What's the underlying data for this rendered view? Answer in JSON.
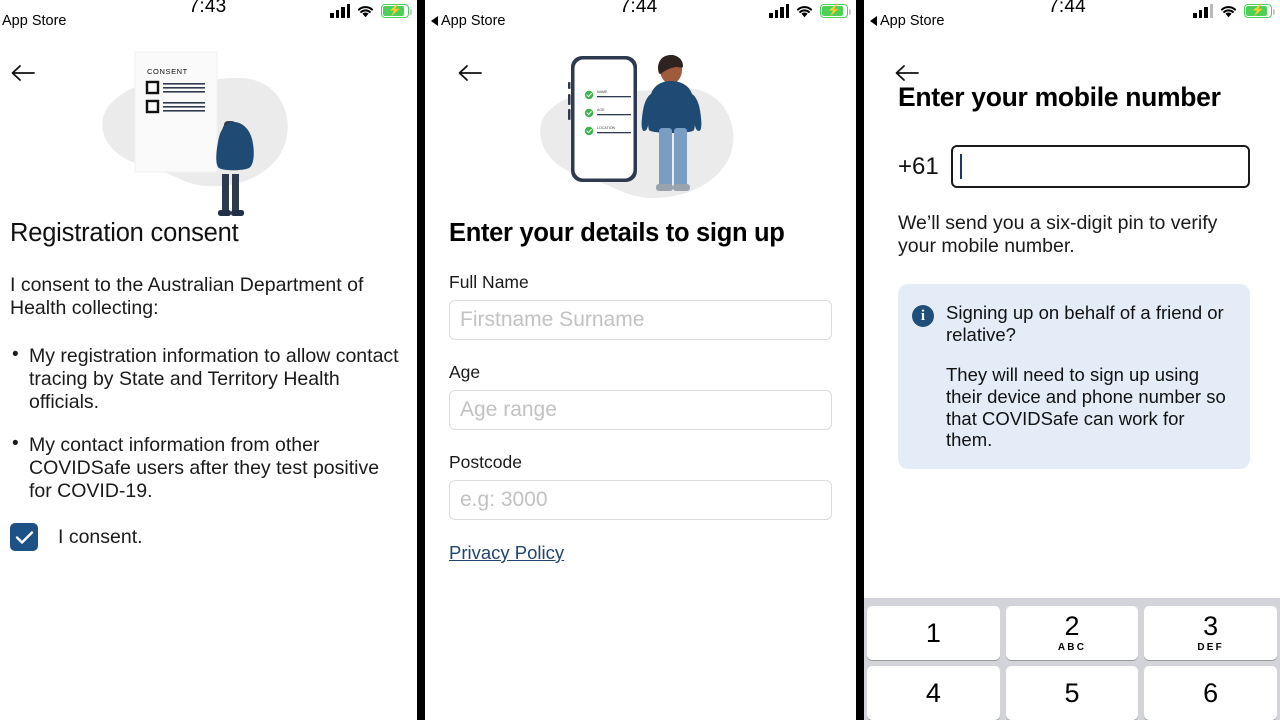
{
  "app": {
    "name": "COVIDSafe"
  },
  "screens": [
    {
      "id": "registration-consent",
      "statusbar": {
        "time": "7:43",
        "back_app": "App Store",
        "signal_icon": "cellular-signal-icon",
        "wifi_icon": "wifi-icon",
        "battery_icon": "battery-charging-icon"
      },
      "back_icon": "back-arrow-icon",
      "illustration": {
        "name": "consent-document-illustration",
        "document_title": "CONSENT"
      },
      "title": "Registration consent",
      "intro": "I consent to the Australian Department of Health collecting:",
      "bullets": [
        "My registration information to allow contact tracing by State and Territory Health officials.",
        "My contact information from other COVIDSafe users after they test positive for COVID-19."
      ],
      "consent": {
        "checked": true,
        "label": "I consent.",
        "checkbox_color": "#1e5185",
        "check_icon": "check-icon"
      }
    },
    {
      "id": "enter-your-details",
      "statusbar": {
        "time": "7:44",
        "back_app": "App Store",
        "signal_icon": "cellular-signal-icon",
        "wifi_icon": "wifi-icon",
        "battery_icon": "battery-charging-icon"
      },
      "back_icon": "back-arrow-icon",
      "illustration": {
        "name": "phone-form-illustration",
        "phone_fields": [
          "NAME",
          "AGE",
          "LOCATION"
        ],
        "check_color": "#3bb54a"
      },
      "title": "Enter your details to sign up",
      "fields": [
        {
          "label": "Full Name",
          "value": "",
          "placeholder": "Firstname Surname"
        },
        {
          "label": "Age",
          "value": "",
          "placeholder": "Age range"
        },
        {
          "label": "Postcode",
          "value": "",
          "placeholder": "e.g: 3000"
        }
      ],
      "privacy_link": "Privacy Policy",
      "link_color": "#22456f"
    },
    {
      "id": "enter-mobile-number",
      "statusbar": {
        "time": "7:44",
        "back_app": "App Store",
        "signal_icon": "cellular-signal-icon",
        "wifi_icon": "wifi-icon",
        "battery_icon": "battery-charging-icon"
      },
      "back_icon": "back-arrow-icon",
      "title": "Enter your mobile number",
      "country_code": "+61",
      "phone_value": "",
      "helper_text": "We’ll send you a six-digit pin to verify your mobile number.",
      "info_box": {
        "icon": "info-circle-icon",
        "icon_color": "#1f4e79",
        "background_color": "#e4edf7",
        "heading": "Signing up on behalf of a friend or relative?",
        "body": "They will need to sign up using their device and phone number so that COVIDSafe can work for them."
      },
      "keypad": {
        "background_color": "#d2d4da",
        "rows": [
          [
            {
              "num": "1",
              "sub": ""
            },
            {
              "num": "2",
              "sub": "ABC"
            },
            {
              "num": "3",
              "sub": "DEF"
            }
          ],
          [
            {
              "num": "4",
              "sub": ""
            },
            {
              "num": "5",
              "sub": ""
            },
            {
              "num": "6",
              "sub": ""
            }
          ]
        ]
      }
    }
  ]
}
